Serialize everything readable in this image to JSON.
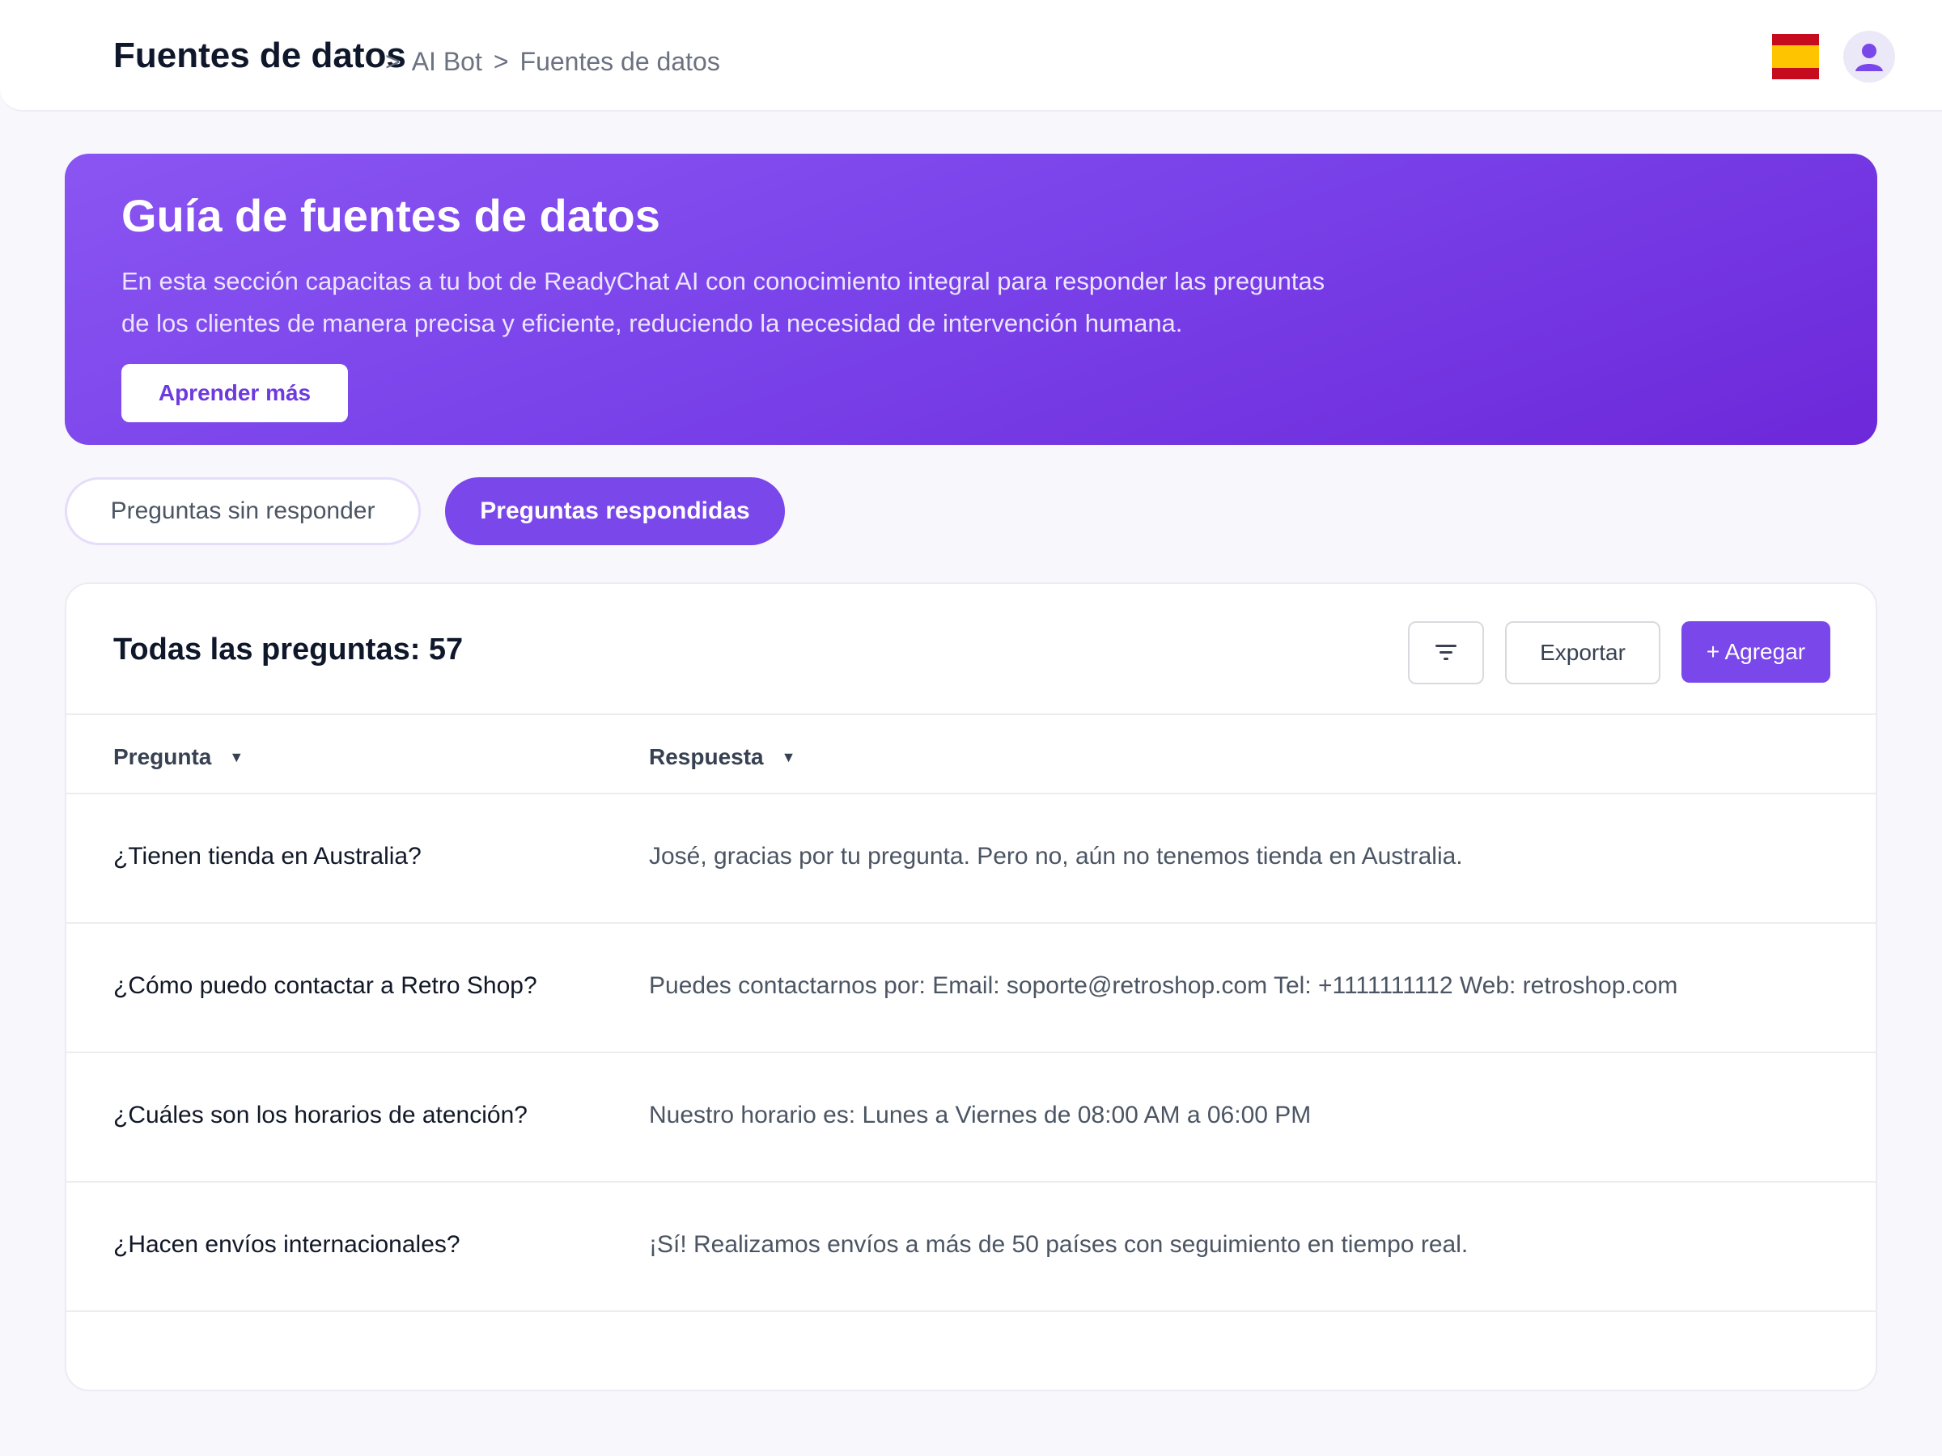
{
  "header": {
    "title": "Fuentes de datos",
    "breadcrumb": [
      ">",
      "AI Bot",
      ">",
      "Fuentes de datos"
    ],
    "language_flag": "spain-flag-icon",
    "user_icon": "user-avatar-icon"
  },
  "banner": {
    "title": "Guía de fuentes de datos",
    "description": "En esta sección capacitas a tu bot de ReadyChat AI con conocimiento integral para responder las preguntas de los clientes de manera precisa y eficiente, reduciendo la necesidad de intervención humana.",
    "learn_more_label": "Aprender más"
  },
  "tabs": [
    {
      "label": "Preguntas sin responder",
      "active": false
    },
    {
      "label": "Preguntas respondidas",
      "active": true
    }
  ],
  "questions": {
    "title": "Todas las preguntas: 57",
    "filter_icon": "filter-icon",
    "export_label": "Exportar",
    "add_label": "+ Agregar",
    "columns": [
      {
        "label": "Pregunta",
        "sort_icon": "▼"
      },
      {
        "label": "Respuesta",
        "sort_icon": "▼"
      }
    ],
    "rows": [
      {
        "question": "¿Tienen tienda en Australia?",
        "answer": "José, gracias por tu pregunta. Pero no, aún no tenemos tienda en Australia."
      },
      {
        "question": "¿Cómo puedo contactar a Retro Shop?",
        "answer": "Puedes contactarnos por: Email: soporte@retroshop.com Tel: +1111111112 Web: retroshop.com"
      },
      {
        "question": "¿Cuáles son los horarios de atención?",
        "answer": "Nuestro horario es: Lunes a Viernes de 08:00 AM a 06:00 PM"
      },
      {
        "question": "¿Hacen envíos internacionales?",
        "answer": "¡Sí! Realizamos envíos a más de 50 países con seguimiento en tiempo real."
      }
    ]
  },
  "colors": {
    "accent": "#7a47ea",
    "banner_start": "#8a55f2",
    "banner_end": "#6d28d9",
    "background": "#f8f7fc"
  }
}
